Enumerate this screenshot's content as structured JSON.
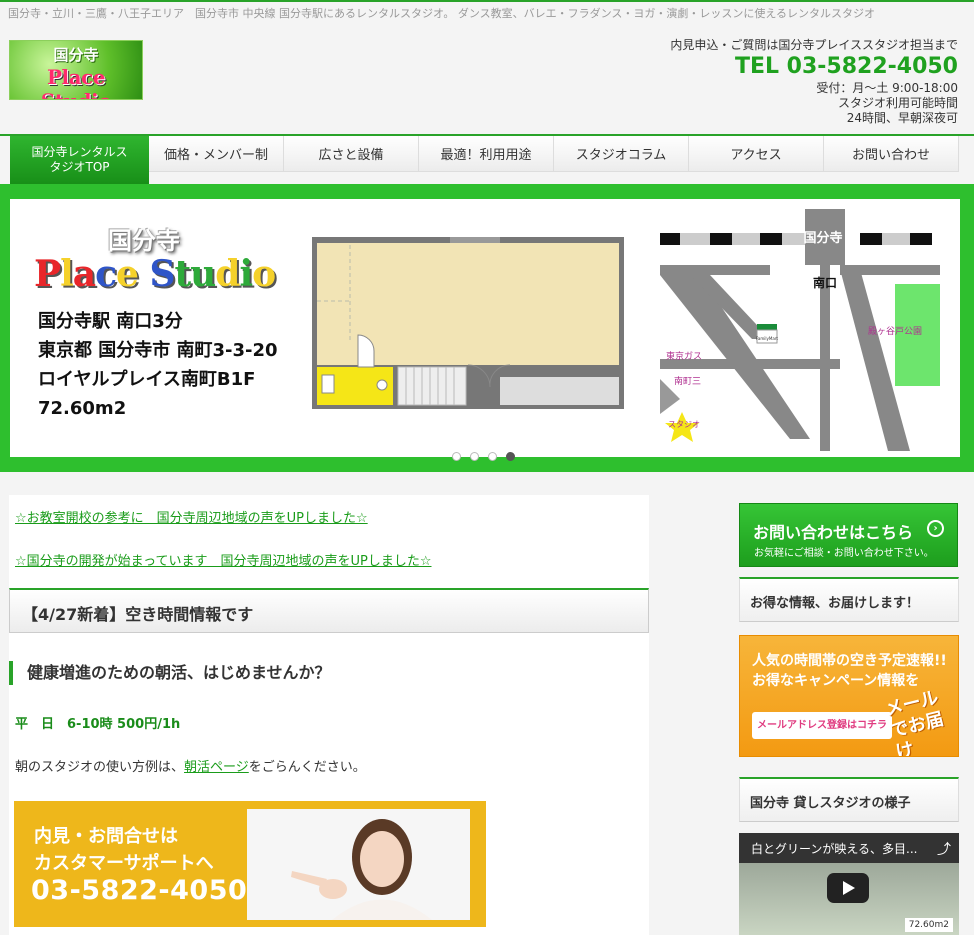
{
  "topbar": {
    "text": "国分寺・立川・三鷹・八王子エリア　国分寺市 中央線 国分寺駅にあるレンタルスタジオ。 ダンス教室、バレエ・フラダンス・ヨガ・演劇・レッスンに使えるレンタルスタジオ"
  },
  "logo": {
    "line1": "国分寺",
    "line2": "Place Studio"
  },
  "contact": {
    "note": "内見申込・ご質問は国分寺プレイススタジオ担当まで",
    "tel": "TEL 03-5822-4050",
    "hours": "受付：月～土 9:00-18:00",
    "usage_label": "スタジオ利用可能時間",
    "usage_value": "24時間、早朝深夜可"
  },
  "nav": {
    "items": [
      {
        "label_line1": "国分寺レンタルス",
        "label_line2": "タジオTOP",
        "active": true
      },
      {
        "label": "価格・メンバー制"
      },
      {
        "label": "広さと設備"
      },
      {
        "label": "最適！利用用途"
      },
      {
        "label": "スタジオコラム"
      },
      {
        "label": "アクセス"
      },
      {
        "label": "お問い合わせ"
      }
    ]
  },
  "slider": {
    "name": "国分寺",
    "place_letters": [
      "P",
      "l",
      "a",
      "c",
      "e",
      " ",
      "S",
      "t",
      "u",
      "d",
      "i",
      "o"
    ],
    "place_colors": [
      "#e8262a",
      "#f5d12b",
      "#e8262a",
      "#2f55c8",
      "#f5d12b",
      "#ffffff",
      "#2f55c8",
      "#2eaa3a",
      "#2eaa3a",
      "#f5d12b",
      "#2eaa3a",
      "#f5d12b"
    ],
    "addr1": "国分寺駅 南口3分",
    "addr2": "東京都 国分寺市 南町3-3-20",
    "addr3": "ロイヤルプレイス南町B1F",
    "addr4": "72.60m2",
    "map_labels": {
      "station": "国分寺",
      "exit": "南口",
      "gas": "東京ガス",
      "town": "南町三",
      "store": "FamilyMart",
      "park": "殿ヶ谷戸公園",
      "studio": "スタジオ"
    },
    "dots": 4,
    "active_dot": 4
  },
  "news": [
    {
      "text": "☆お教室開校の参考に　国分寺周辺地域の声をUPしました☆"
    },
    {
      "text": "☆国分寺の開発が始まっています　国分寺周辺地域の声をUPしました☆"
    }
  ],
  "main": {
    "heading": "【4/27新着】空き時間情報です",
    "subheading": "健康増進のための朝活、はじめませんか？",
    "price": "平　日　6-10時 500円/1h",
    "para_before": "朝のスタジオの使い方例は、",
    "para_link": "朝活ページ",
    "para_after": "をごらんください。",
    "banner_line1": "内見・お問合せは",
    "banner_line2": "カスタマーサポートへ",
    "banner_tel": "03-5822-4050"
  },
  "sidebar": {
    "contact_title": "お問い合わせはこちら",
    "contact_sub": "お気軽にご相談・お問い合わせ下さい。",
    "deals_heading": "お得な情報、お届けします！",
    "promo_line1": "人気の時間帯の空き予定速報!!",
    "promo_line2": "お得なキャンペーン情報を",
    "promo_button": "メールアドレス登録はコチラ",
    "promo_mail1": "メール",
    "promo_mail2": "でお届け",
    "studio_heading": "国分寺 貸しスタジオの様子",
    "video_title": "白とグリーンが映える、多目...",
    "video_badge": "72.60m2"
  }
}
